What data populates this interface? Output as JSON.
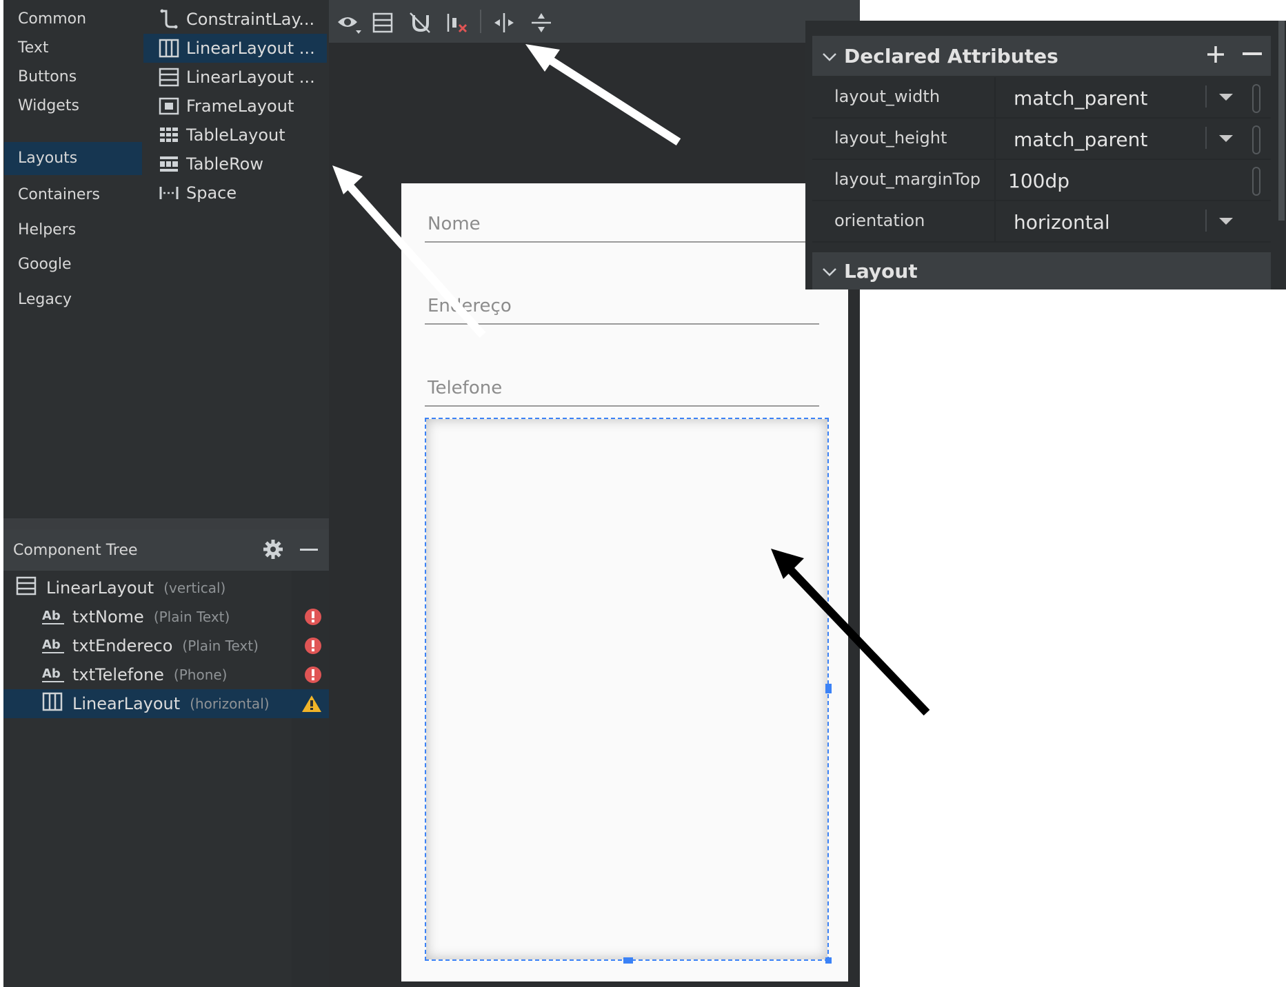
{
  "palette": {
    "categories": [
      "Common",
      "Text",
      "Buttons",
      "Widgets",
      "Layouts",
      "Containers",
      "Helpers",
      "Google",
      "Legacy"
    ],
    "selected_category": "Layouts",
    "components": [
      {
        "label": "ConstraintLay...",
        "icon": "constraint-layout-icon"
      },
      {
        "label": "LinearLayout ...",
        "icon": "linear-layout-horizontal-icon"
      },
      {
        "label": "LinearLayout ...",
        "icon": "linear-layout-vertical-icon"
      },
      {
        "label": "FrameLayout",
        "icon": "frame-layout-icon"
      },
      {
        "label": "TableLayout",
        "icon": "table-layout-icon"
      },
      {
        "label": "TableRow",
        "icon": "table-row-icon"
      },
      {
        "label": "Space",
        "icon": "space-icon"
      }
    ]
  },
  "component_tree": {
    "title": "Component Tree",
    "rows": [
      {
        "name": "LinearLayout",
        "detail": "(vertical)",
        "icon": "linear-layout-vertical-icon",
        "status": ""
      },
      {
        "name": "txtNome",
        "detail": "(Plain Text)",
        "icon": "text-field-icon",
        "status": "error"
      },
      {
        "name": "txtEndereco",
        "detail": "(Plain Text)",
        "icon": "text-field-icon",
        "status": "error"
      },
      {
        "name": "txtTelefone",
        "detail": "(Phone)",
        "icon": "text-field-icon",
        "status": "error"
      },
      {
        "name": "LinearLayout",
        "detail": "(horizontal)",
        "icon": "linear-layout-horizontal-icon",
        "status": "warning"
      }
    ]
  },
  "toolbar": {
    "icons": [
      "eye-icon",
      "blueprint-icon",
      "magnet-icon",
      "clear-constraints-icon",
      "expand-horizontal-icon",
      "expand-vertical-icon"
    ]
  },
  "preview": {
    "fields": [
      "Nome",
      "Endereço",
      "Telefone"
    ]
  },
  "attributes": {
    "section_title": "Declared Attributes",
    "rows": [
      {
        "key": "layout_width",
        "value": "match_parent",
        "dropdown": true
      },
      {
        "key": "layout_height",
        "value": "match_parent",
        "dropdown": true
      },
      {
        "key": "layout_marginTop",
        "value": "100dp",
        "dropdown": false
      },
      {
        "key": "orientation",
        "value": "horizontal",
        "dropdown": true
      }
    ],
    "next_section": "Layout"
  },
  "colors": {
    "panel_bg": "#2d3032",
    "selection": "#163651",
    "error": "#e05555",
    "warning": "#f0b429"
  }
}
